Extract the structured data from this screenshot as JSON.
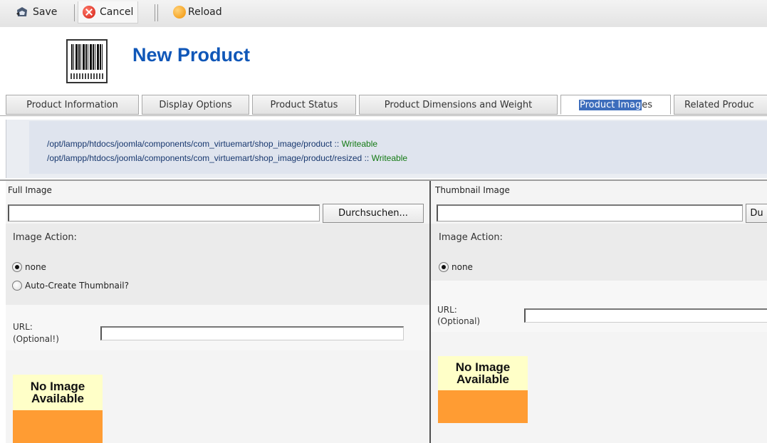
{
  "toolbar": {
    "save_label": "Save",
    "cancel_label": "Cancel",
    "reload_label": "Reload"
  },
  "page_title": "New Product",
  "tabs": [
    {
      "label": "Product Information"
    },
    {
      "label": "Display Options"
    },
    {
      "label": "Product Status"
    },
    {
      "label": "Product Dimensions and Weight"
    },
    {
      "label_selected": "Product Imag",
      "label_rest": "es",
      "active": true
    },
    {
      "label": "Related Produc"
    }
  ],
  "paths": [
    {
      "path": "/opt/lampp/htdocs/joomla/components/com_virtuemart/shop_image/product",
      "separator": " :: ",
      "status": "Writeable"
    },
    {
      "path": "/opt/lampp/htdocs/joomla/components/com_virtuemart/shop_image/product/resized",
      "separator": " :: ",
      "status": "Writeable"
    }
  ],
  "full_image": {
    "title": "Full Image",
    "browse_label": "Durchsuchen...",
    "image_action_label": "Image Action:",
    "option_none": "none",
    "option_auto": "Auto-Create Thumbnail?",
    "url_label_1": "URL:",
    "url_label_2": "(Optional!)",
    "url_value": "",
    "no_image_line1": "No Image",
    "no_image_line2": "Available"
  },
  "thumbnail_image": {
    "title": "Thumbnail Image",
    "browse_label": "Du",
    "image_action_label": "Image Action:",
    "option_none": "none",
    "url_label_1": "URL:",
    "url_label_2": "(Optional)",
    "url_value": "",
    "no_image_line1": "No Image",
    "no_image_line2": "Available"
  },
  "colors": {
    "title": "#1057b8",
    "path_text": "#17376e",
    "writeable": "#137a13",
    "no_image_top": "#ffffc8",
    "no_image_bottom": "#ff9c33",
    "tab_selection": "#3d6dbc"
  },
  "icons": {
    "save": "save-disk-icon",
    "cancel": "cancel-icon",
    "reload": "reload-icon",
    "product": "barcode-icon"
  }
}
